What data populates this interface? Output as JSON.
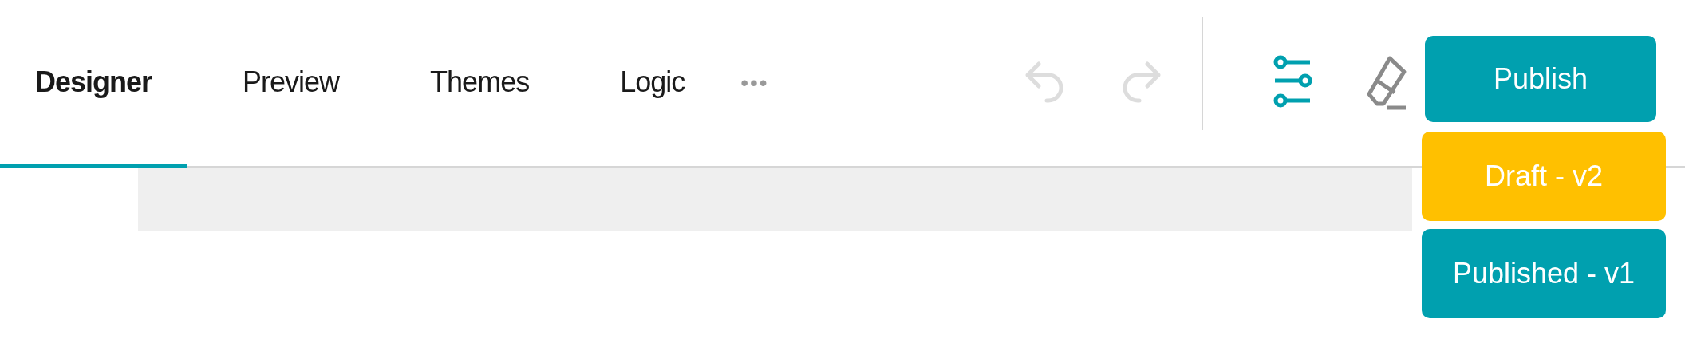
{
  "tabs": [
    {
      "label": "Designer",
      "selected": true
    },
    {
      "label": "Preview",
      "selected": false
    },
    {
      "label": "Themes",
      "selected": false
    },
    {
      "label": "Logic",
      "selected": false
    }
  ],
  "more_button": {
    "label": "•••"
  },
  "toolbar": {
    "undo": {
      "disabled": true
    },
    "redo": {
      "disabled": true
    },
    "settings": {
      "selected": true
    }
  },
  "publish_button": {
    "label": "Publish"
  },
  "version_menu": [
    {
      "label": "Draft - v2",
      "color": "#ffc000"
    },
    {
      "label": "Published - v1",
      "color": "#00a0af"
    }
  ]
}
